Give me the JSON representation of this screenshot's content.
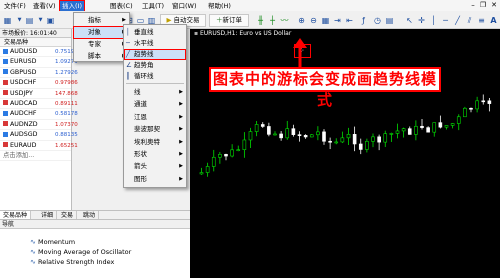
{
  "menubar": {
    "items": [
      "文件(F)",
      "查看(V)",
      "插入(I)",
      "图表(C)",
      "工具(T)",
      "窗口(W)",
      "帮助(H)"
    ],
    "active_index": 2
  },
  "toolbar": {
    "new_order": "新订单",
    "auto_trading": "自动交易",
    "timeframes": "M1 M5 M15 M30 H1 H4 D1 W1 MN"
  },
  "insert_menu": {
    "items": [
      {
        "label": "指标",
        "has_arrow": true
      },
      {
        "label": "对象",
        "has_arrow": true,
        "highlight": true
      },
      {
        "label": "专家",
        "has_arrow": true
      },
      {
        "label": "脚本",
        "has_arrow": true
      }
    ]
  },
  "objects_menu": {
    "items": [
      {
        "label": "垂直线",
        "icon": "vertical-line-icon",
        "glyph": "│"
      },
      {
        "label": "水平线",
        "icon": "horizontal-line-icon",
        "glyph": "─"
      },
      {
        "label": "趋势线",
        "icon": "trend-line-icon",
        "glyph": "╱",
        "highlight": true
      },
      {
        "label": "趋势角",
        "icon": "trend-angle-icon",
        "glyph": "∠"
      },
      {
        "label": "循环线",
        "icon": "cycle-lines-icon",
        "glyph": "┃"
      },
      {
        "label": "线",
        "has_arrow": true
      },
      {
        "label": "通道",
        "has_arrow": true
      },
      {
        "label": "江恩",
        "has_arrow": true
      },
      {
        "label": "斐波那契",
        "has_arrow": true
      },
      {
        "label": "埃利奥特",
        "has_arrow": true
      },
      {
        "label": "形状",
        "has_arrow": true
      },
      {
        "label": "箭头",
        "has_arrow": true
      },
      {
        "label": "图形",
        "has_arrow": true
      }
    ]
  },
  "market_watch": {
    "title": "市场报价: 16:01:40",
    "header": "交易品种",
    "rows": [
      {
        "symbol": "AUDUSD",
        "price": "0.75196",
        "dir": "up"
      },
      {
        "symbol": "EURUSD",
        "price": "1.09279",
        "dir": "up"
      },
      {
        "symbol": "GBPUSD",
        "price": "1.27926",
        "dir": "up"
      },
      {
        "symbol": "USDCHF",
        "price": "0.97986",
        "dir": "down"
      },
      {
        "symbol": "USDJPY",
        "price": "147.868",
        "dir": "down"
      },
      {
        "symbol": "AUDCAD",
        "price": "0.89111",
        "dir": "down"
      },
      {
        "symbol": "AUDCHF",
        "price": "0.58178",
        "dir": "up"
      },
      {
        "symbol": "AUDNZD",
        "price": "1.07370",
        "dir": "down"
      },
      {
        "symbol": "AUDSGD",
        "price": "0.88135",
        "dir": "up"
      },
      {
        "symbol": "EURAUD",
        "price": "1.65251",
        "dir": "down"
      }
    ],
    "add_row": "点击添加..."
  },
  "tabs": [
    "交易品种",
    "详细",
    "交易",
    "跳动"
  ],
  "navigator": {
    "title": "导航",
    "items": [
      "Momentum",
      "Moving Average of Oscillator",
      "Relative Strength Index"
    ]
  },
  "chart": {
    "title": "EURUSD,H1: Euro vs US Dollar"
  },
  "annotation": {
    "text": "图表中的游标会变成画趋势线模式"
  },
  "colors": {
    "accent": "#2a6fd1",
    "annotation": "#ff0000",
    "bull_candle": "#00e000",
    "bear_candle": "#ffffff"
  }
}
